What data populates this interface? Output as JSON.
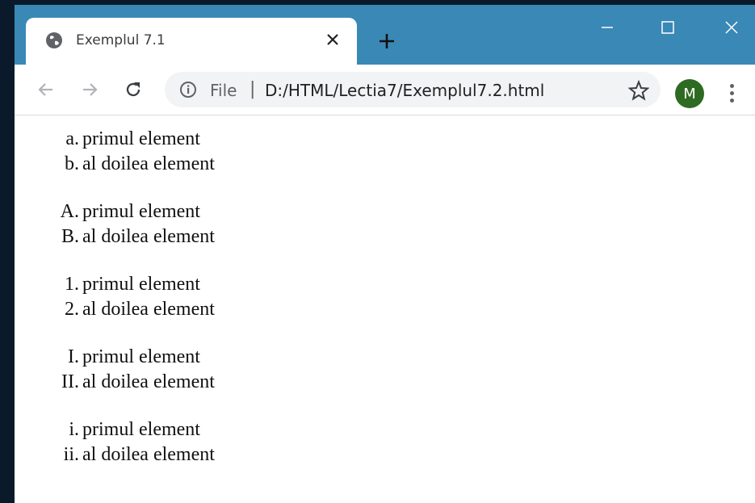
{
  "window": {
    "tab_title": "Exemplul 7.1",
    "new_tab_label": "+",
    "minimize_label": "—",
    "close_label": "✕"
  },
  "toolbar": {
    "file_label": "File",
    "separator": "|",
    "url": "D:/HTML/Lectia7/Exemplul7.2.html",
    "avatar_initial": "M"
  },
  "lists": [
    {
      "items": [
        {
          "marker": "a.",
          "text": "primul element"
        },
        {
          "marker": "b.",
          "text": "al doilea element"
        }
      ]
    },
    {
      "items": [
        {
          "marker": "A.",
          "text": "primul element"
        },
        {
          "marker": "B.",
          "text": "al doilea element"
        }
      ]
    },
    {
      "items": [
        {
          "marker": "1.",
          "text": "primul element"
        },
        {
          "marker": "2.",
          "text": "al doilea element"
        }
      ]
    },
    {
      "items": [
        {
          "marker": "I.",
          "text": "primul element"
        },
        {
          "marker": "II.",
          "text": "al doilea element"
        }
      ]
    },
    {
      "items": [
        {
          "marker": "i.",
          "text": "primul element"
        },
        {
          "marker": "ii.",
          "text": "al doilea element"
        }
      ]
    }
  ]
}
